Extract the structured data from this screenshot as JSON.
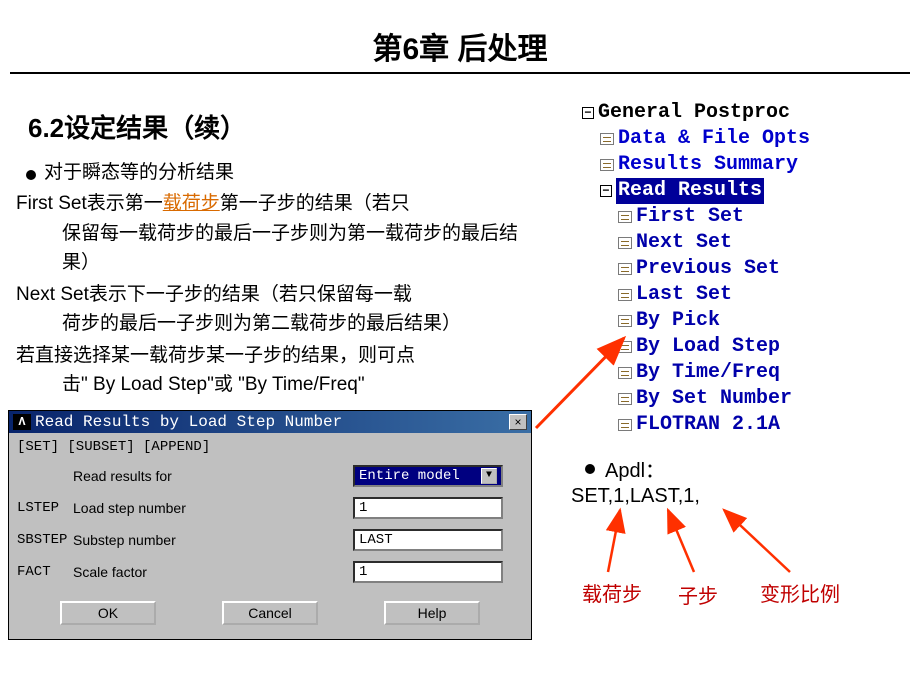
{
  "slide": {
    "title": "第6章 后处理",
    "subtitle": "6.2设定结果（续）"
  },
  "content": {
    "b1": "对于瞬态等的分析结果",
    "p2_head": "First Set表示第一",
    "p2_link": "载荷步",
    "p2_tail": "第一子步的结果（若只",
    "p2_cont": "保留每一载荷步的最后一子步则为第一载荷步的最后结果）",
    "p3_head": "Next Set表示下一子步的结果（若只保留每一载",
    "p3_cont": "荷步的最后一子步则为第二载荷步的最后结果）",
    "p4_head": "若直接选择某一载荷步某一子步的结果，则可点",
    "p4_cont": "击\" By Load Step\"或 \"By Time/Freq\""
  },
  "tree": {
    "root": "General Postproc",
    "i1": "Data & File Opts",
    "i2": "Results Summary",
    "i3": "Read Results",
    "s1": "First Set",
    "s2": "Next Set",
    "s3": "Previous Set",
    "s4": "Last Set",
    "s5": "By Pick",
    "s6": "By Load Step",
    "s7": "By Time/Freq",
    "s8": "By Set Number",
    "s9": "FLOTRAN 2.1A"
  },
  "dialog": {
    "title": "Read Results by Load Step Number",
    "hdr": "[SET] [SUBSET] [APPEND]",
    "row1_label": "Read results for",
    "row1_value": "Entire model",
    "lstep_code": "LSTEP",
    "lstep_label": "Load step number",
    "lstep_value": "1",
    "sbstep_code": "SBSTEP",
    "sbstep_label": "Substep number",
    "sbstep_value": "LAST",
    "fact_code": "FACT",
    "fact_label": "Scale factor",
    "fact_value": "1",
    "ok": "OK",
    "cancel": "Cancel",
    "help": "Help"
  },
  "apdl": {
    "label": "Apdl：",
    "cmd": "SET,1,LAST,1,",
    "anno1": "载荷步",
    "anno2": "子步",
    "anno3": "变形比例"
  }
}
